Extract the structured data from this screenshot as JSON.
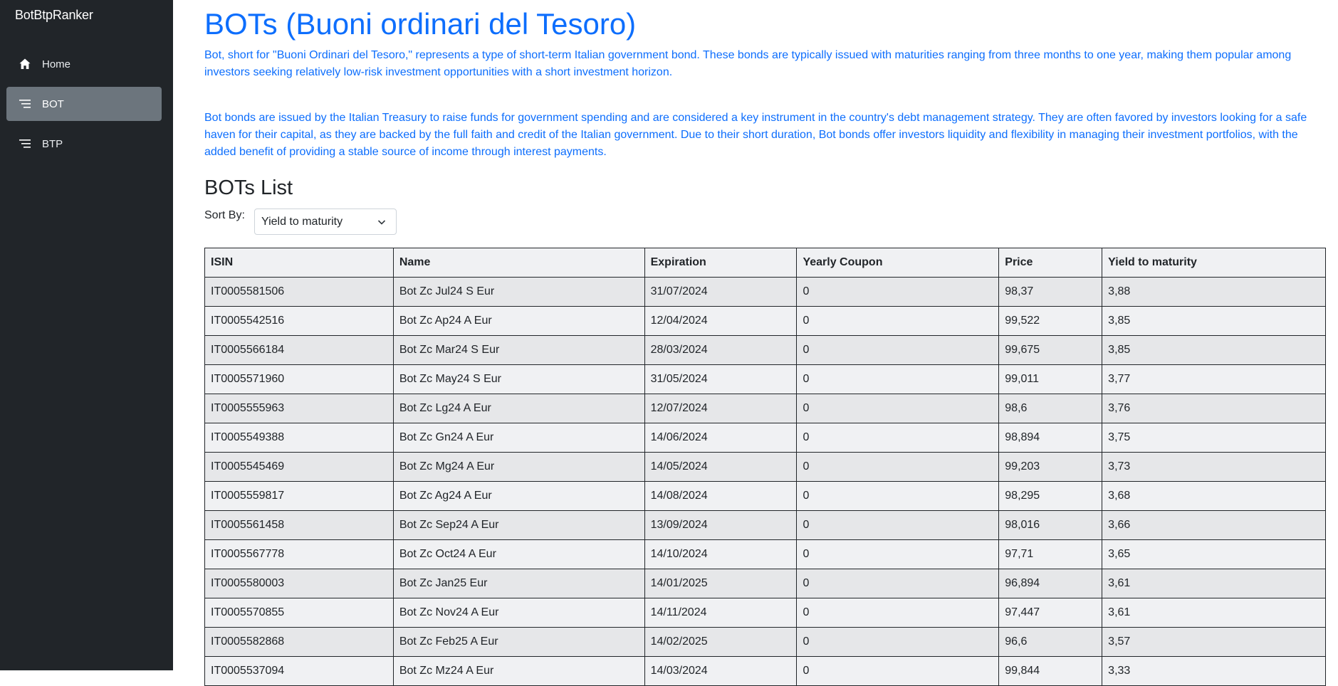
{
  "app": {
    "brand": "BotBtpRanker"
  },
  "sidebar": {
    "items": [
      {
        "label": "Home",
        "icon": "home-icon",
        "active": false
      },
      {
        "label": "BOT",
        "icon": "list-icon",
        "active": true
      },
      {
        "label": "BTP",
        "icon": "list-icon",
        "active": false
      }
    ]
  },
  "main": {
    "title": "BOTs (Buoni ordinari del Tesoro)",
    "intro_p1": "Bot, short for \"Buoni Ordinari del Tesoro,\" represents a type of short-term Italian government bond. These bonds are typically issued with maturities ranging from three months to one year, making them popular among investors seeking relatively low-risk investment opportunities with a short investment horizon.",
    "intro_p2": "Bot bonds are issued by the Italian Treasury to raise funds for government spending and are considered a key instrument in the country's debt management strategy. They are often favored by investors looking for a safe haven for their capital, as they are backed by the full faith and credit of the Italian government. Due to their short duration, Bot bonds offer investors liquidity and flexibility in managing their investment portfolios, with the added benefit of providing a stable source of income through interest payments.",
    "list_title": "BOTs List",
    "sort_label": "Sort By:",
    "sort_value": "Yield to maturity"
  },
  "table": {
    "headers": [
      "ISIN",
      "Name",
      "Expiration",
      "Yearly Coupon",
      "Price",
      "Yield to maturity"
    ],
    "rows": [
      [
        "IT0005581506",
        "Bot Zc Jul24 S Eur",
        "31/07/2024",
        "0",
        "98,37",
        "3,88"
      ],
      [
        "IT0005542516",
        "Bot Zc Ap24 A Eur",
        "12/04/2024",
        "0",
        "99,522",
        "3,85"
      ],
      [
        "IT0005566184",
        "Bot Zc Mar24 S Eur",
        "28/03/2024",
        "0",
        "99,675",
        "3,85"
      ],
      [
        "IT0005571960",
        "Bot Zc May24 S Eur",
        "31/05/2024",
        "0",
        "99,011",
        "3,77"
      ],
      [
        "IT0005555963",
        "Bot Zc Lg24 A Eur",
        "12/07/2024",
        "0",
        "98,6",
        "3,76"
      ],
      [
        "IT0005549388",
        "Bot Zc Gn24 A Eur",
        "14/06/2024",
        "0",
        "98,894",
        "3,75"
      ],
      [
        "IT0005545469",
        "Bot Zc Mg24 A Eur",
        "14/05/2024",
        "0",
        "99,203",
        "3,73"
      ],
      [
        "IT0005559817",
        "Bot Zc Ag24 A Eur",
        "14/08/2024",
        "0",
        "98,295",
        "3,68"
      ],
      [
        "IT0005561458",
        "Bot Zc Sep24 A Eur",
        "13/09/2024",
        "0",
        "98,016",
        "3,66"
      ],
      [
        "IT0005567778",
        "Bot Zc Oct24 A Eur",
        "14/10/2024",
        "0",
        "97,71",
        "3,65"
      ],
      [
        "IT0005580003",
        "Bot Zc Jan25 Eur",
        "14/01/2025",
        "0",
        "96,894",
        "3,61"
      ],
      [
        "IT0005570855",
        "Bot Zc Nov24 A Eur",
        "14/11/2024",
        "0",
        "97,447",
        "3,61"
      ],
      [
        "IT0005582868",
        "Bot Zc Feb25 A Eur",
        "14/02/2025",
        "0",
        "96,6",
        "3,57"
      ],
      [
        "IT0005537094",
        "Bot Zc Mz24 A Eur",
        "14/03/2024",
        "0",
        "99,844",
        "3,33"
      ]
    ]
  }
}
